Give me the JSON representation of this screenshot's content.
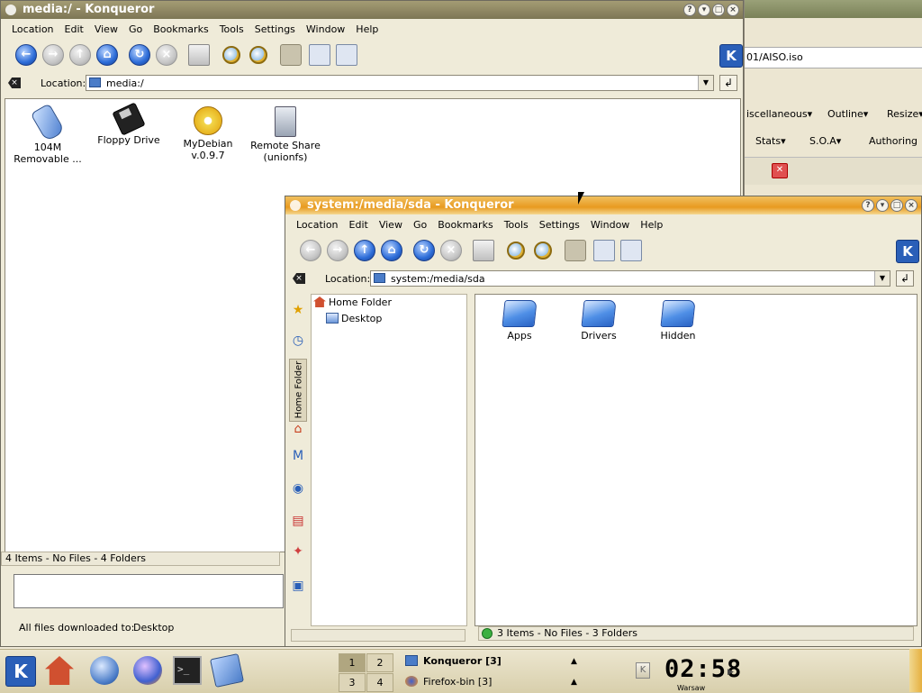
{
  "bg_window": {
    "url_text": "01/AISO.iso",
    "toolbar1": [
      "iscellaneous▾",
      "Outline▾",
      "Resize▾"
    ],
    "toolbar2": [
      "Stats▾",
      "S.O.A▾",
      "Authoring"
    ],
    "tab_close": "✕"
  },
  "win_back": {
    "title": "media:/ - Konqueror",
    "menu": [
      "Location",
      "Edit",
      "View",
      "Go",
      "Bookmarks",
      "Tools",
      "Settings",
      "Window",
      "Help"
    ],
    "location_label": "Location:",
    "location_value": "media:/",
    "items": [
      {
        "label": "104M Removable ...",
        "icon": "usb-drive-icon"
      },
      {
        "label": "Floppy Drive",
        "icon": "floppy-icon"
      },
      {
        "label": "MyDebian v.0.9.7",
        "icon": "cdrom-icon"
      },
      {
        "label": "Remote Share (unionfs)",
        "icon": "network-share-icon"
      }
    ],
    "status": "4 Items - No Files - 4 Folders",
    "downloads_label": "All files downloaded to:",
    "downloads_value": "Desktop"
  },
  "win_front": {
    "title": "system:/media/sda - Konqueror",
    "menu": [
      "Location",
      "Edit",
      "View",
      "Go",
      "Bookmarks",
      "Tools",
      "Settings",
      "Window",
      "Help"
    ],
    "location_label": "Location:",
    "location_value": "system:/media/sda",
    "sidebar_tab": "Home Folder",
    "tree": [
      {
        "label": "Home Folder",
        "icon": "home-icon"
      },
      {
        "label": "Desktop",
        "icon": "desktop-icon"
      }
    ],
    "items": [
      {
        "label": "Apps",
        "icon": "folder-icon"
      },
      {
        "label": "Drivers",
        "icon": "folder-icon"
      },
      {
        "label": "Hidden",
        "icon": "folder-icon"
      }
    ],
    "status": "3 Items - No Files - 3 Folders"
  },
  "taskbar": {
    "pager": [
      "1",
      "2",
      "3",
      "4"
    ],
    "tasks": [
      {
        "label": "Konqueror [3]",
        "icon": "konqueror-icon"
      },
      {
        "label": "Firefox-bin [3]",
        "icon": "firefox-icon"
      }
    ],
    "clock": "02:58",
    "timezone": "Warsaw"
  },
  "colors": {
    "active_title": "#e89a20",
    "inactive_title": "#7d7655",
    "panel": "#efebd9"
  }
}
